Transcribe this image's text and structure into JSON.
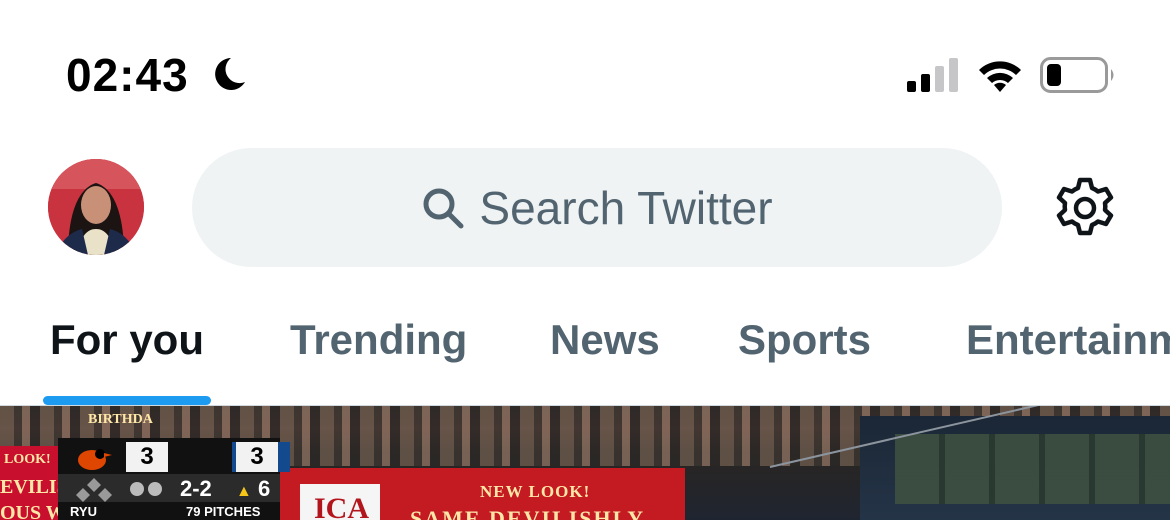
{
  "status_bar": {
    "time": "02:43",
    "focus_icon": "moon-icon",
    "signal_icon": "cellular-signal-icon",
    "wifi_icon": "wifi-icon",
    "battery_icon": "battery-icon"
  },
  "header": {
    "avatar": "profile-avatar",
    "search_placeholder": "Search Twitter",
    "search_icon": "search-icon",
    "settings_icon": "gear-icon"
  },
  "tabs": [
    {
      "label": "For you",
      "active": true
    },
    {
      "label": "Trending",
      "active": false
    },
    {
      "label": "News",
      "active": false
    },
    {
      "label": "Sports",
      "active": false
    },
    {
      "label": "Entertainment",
      "active": false
    }
  ],
  "media": {
    "scorebug": {
      "away_score": "3",
      "home_score": "3",
      "count": "2-2",
      "inning": "6",
      "pitcher": "RYU",
      "pitches": "79 PITCHES"
    },
    "board_text": {
      "banner_top": "BIRTHDA",
      "left_1": "LOOK!",
      "left_2": "EVILISI",
      "left_3": "OUS WI",
      "logo_fragment": "ICA",
      "promo_1": "NEW LOOK!",
      "promo_2": "SAME DEVILISHLY"
    }
  },
  "colors": {
    "accent": "#1d9bf0",
    "search_bg": "#eff3f4",
    "tab_inactive": "#536471",
    "tab_active": "#0f1419"
  }
}
